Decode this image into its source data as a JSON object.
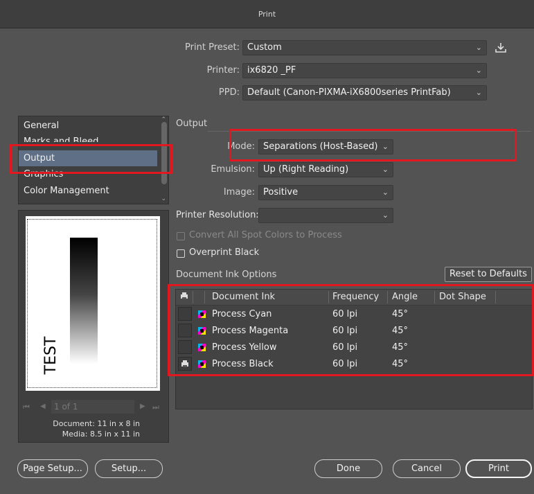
{
  "window": {
    "title": "Print"
  },
  "print_preset": {
    "label": "Print Preset:",
    "value": "Custom"
  },
  "printer": {
    "label": "Printer:",
    "value": "ix6820 _PF"
  },
  "ppd": {
    "label": "PPD:",
    "value": "Default (Canon-PIXMA-iX6800series PrintFab)"
  },
  "sidebar": {
    "items": [
      {
        "label": "General"
      },
      {
        "label": "Marks and Bleed"
      },
      {
        "label": "Output"
      },
      {
        "label": "Graphics"
      },
      {
        "label": "Color Management"
      }
    ],
    "selected": "Output"
  },
  "preview": {
    "text": "TEST",
    "page_indicator": "1 of 1",
    "document_size": "Document: 11 in x 8 in",
    "media_size": "Media: 8.5 in x 11 in"
  },
  "output": {
    "section_title": "Output",
    "mode": {
      "label": "Mode:",
      "value": "Separations (Host-Based)"
    },
    "emulsion": {
      "label": "Emulsion:",
      "value": "Up (Right Reading)"
    },
    "image": {
      "label": "Image:",
      "value": "Positive"
    },
    "printer_resolution": {
      "label": "Printer Resolution:",
      "value": ""
    },
    "convert_spot": {
      "label": "Convert All Spot Colors to Process",
      "checked": false,
      "enabled": false
    },
    "overprint_black": {
      "label": "Overprint Black",
      "checked": false
    }
  },
  "ink_options": {
    "title": "Document Ink Options",
    "reset_label": "Reset to Defaults",
    "columns": [
      "Document Ink",
      "Frequency",
      "Angle",
      "Dot Shape"
    ],
    "rows": [
      {
        "ink": "Process Cyan",
        "frequency": "60 lpi",
        "angle": "45°",
        "dot_shape": "",
        "print": false
      },
      {
        "ink": "Process Magenta",
        "frequency": "60 lpi",
        "angle": "45°",
        "dot_shape": "",
        "print": false
      },
      {
        "ink": "Process Yellow",
        "frequency": "60 lpi",
        "angle": "45°",
        "dot_shape": "",
        "print": false
      },
      {
        "ink": "Process Black",
        "frequency": "60 lpi",
        "angle": "45°",
        "dot_shape": "",
        "print": true
      }
    ]
  },
  "buttons": {
    "page_setup": "Page Setup...",
    "setup": "Setup...",
    "done": "Done",
    "cancel": "Cancel",
    "print": "Print"
  },
  "colors": {
    "highlight": "#e1181f",
    "selection": "#5e6f86",
    "background": "#535353"
  }
}
